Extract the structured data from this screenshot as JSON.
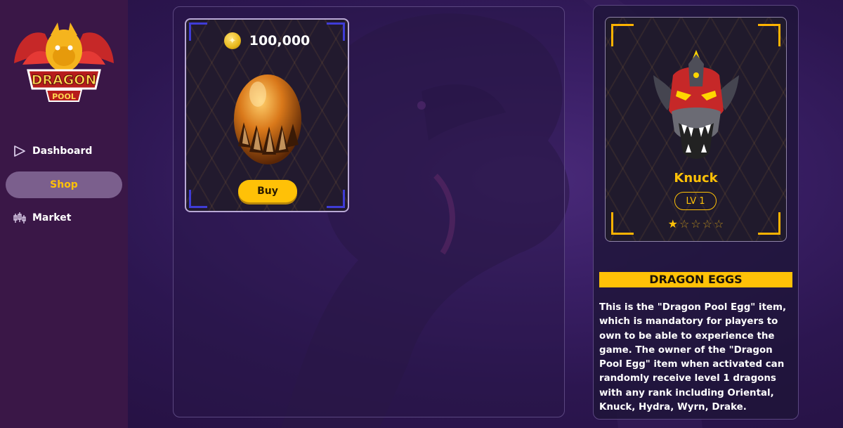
{
  "sidebar": {
    "logo": {
      "line1": "DRAGON",
      "line2": "POOL"
    },
    "items": [
      {
        "label": "Dashboard",
        "icon": "play-triangle-icon",
        "active": false
      },
      {
        "label": "Shop",
        "icon": "",
        "active": true
      },
      {
        "label": "Market",
        "icon": "candlestick-chart-icon",
        "active": false
      }
    ]
  },
  "shop": {
    "item": {
      "price": "100,000",
      "currency_icon": "gold-coin-icon",
      "image": "dragon-egg",
      "buy_label": "Buy"
    }
  },
  "detail": {
    "dragon": {
      "name": "Knuck",
      "level": "LV 1",
      "stars_filled": 1,
      "stars_total": 5
    },
    "section_title": "DRAGON EGGS",
    "description": "This is the \"Dragon Pool Egg\" item, which is mandatory for players to own to be able to experience the game. The owner of the \"Dragon Pool Egg\" item when activated can randomly receive level 1 dragons with any rank including Oriental, Knuck, Hydra, Wyrn, Drake."
  },
  "colors": {
    "accent": "#ffc107",
    "sidebar_bg": "#3a1747",
    "active_nav_bg": "#7b5f8d",
    "card_corner_blue": "#3f3cd6"
  }
}
